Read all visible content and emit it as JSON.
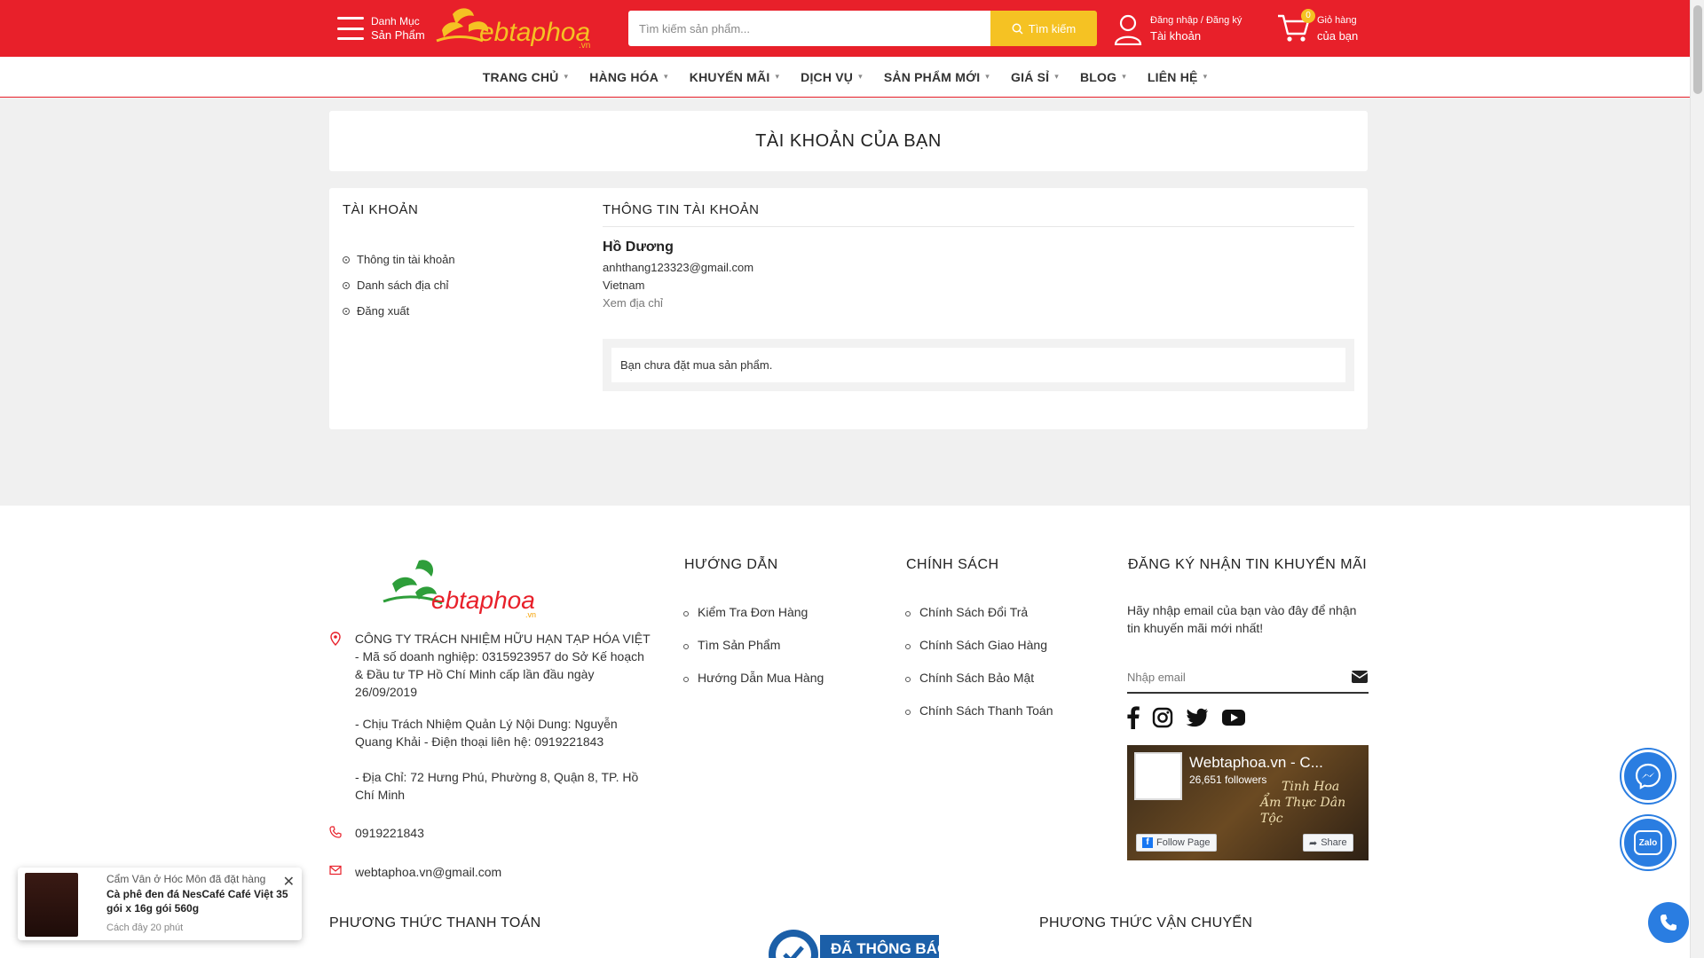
{
  "header": {
    "menu_line1": "Danh Mục",
    "menu_line2": "Sản Phẩm",
    "logo_text": "ebtaphoa",
    "logo_suffix": ".vn",
    "search_placeholder": "Tìm kiếm sản phẩm...",
    "search_button": "Tìm kiếm",
    "account_line1": "Đăng nhập / Đăng ký",
    "account_line2": "Tài khoản",
    "cart_count": "0",
    "cart_line1": "Giỏ hàng",
    "cart_line2": "của bạn",
    "brand_color": "#e8202a",
    "accent_color": "#f5c223"
  },
  "nav": {
    "items": [
      {
        "label": "TRANG CHỦ"
      },
      {
        "label": "HÀNG HÓA"
      },
      {
        "label": "KHUYẾN MÃI"
      },
      {
        "label": "DỊCH VỤ"
      },
      {
        "label": "SẢN PHẨM MỚI"
      },
      {
        "label": "GIÁ SỈ"
      },
      {
        "label": "BLOG"
      },
      {
        "label": "LIÊN HỆ"
      }
    ]
  },
  "page": {
    "title": "TÀI KHOẢN CỦA BẠN"
  },
  "sidebar": {
    "title": "TÀI KHOẢN",
    "items": [
      {
        "label": "Thông tin tài khoản"
      },
      {
        "label": "Danh sách địa chỉ"
      },
      {
        "label": "Đăng xuất"
      }
    ]
  },
  "account_info": {
    "title": "THÔNG TIN TÀI KHOẢN",
    "name": "Hồ Dương",
    "email": "anhthang123323@gmail.com",
    "country": "Vietnam",
    "address_link": "Xem địa chỉ",
    "orders_message": "Bạn chưa đặt mua sản phẩm."
  },
  "footer": {
    "company": "CÔNG TY TRÁCH NHIỆM HỮU HẠN TẠP HÓA VIỆT - Mã số doanh nghiệp: 0315923957 do Sở Kế hoạch & Đầu tư TP Hồ Chí Minh cấp lần đầu ngày 26/09/2019",
    "manager": "- Chịu Trách Nhiệm Quản Lý Nội Dung: Nguyễn Quang Khải - Điện thoại liên hệ: 0919221843",
    "address": "- Địa Chỉ: 72 Hưng Phú, Phường 8, Quận 8, TP. Hồ Chí Minh",
    "phone": "0919221843",
    "email": "webtaphoa.vn@gmail.com",
    "guide_title": "HƯỚNG DẪN",
    "guide_items": [
      {
        "label": "Kiểm Tra Đơn Hàng"
      },
      {
        "label": "Tìm Sản Phẩm"
      },
      {
        "label": "Hướng Dẫn Mua Hàng"
      }
    ],
    "policy_title": "CHÍNH SÁCH",
    "policy_items": [
      {
        "label": "Chính Sách Đổi Trả"
      },
      {
        "label": "Chính Sách Giao Hàng"
      },
      {
        "label": "Chính Sách Bảo Mật"
      },
      {
        "label": "Chính Sách Thanh Toán"
      }
    ],
    "subscribe_title": "ĐĂNG KÝ NHẬN TIN KHUYẾN MÃI",
    "subscribe_desc": "Hãy nhập email của bạn vào đây để nhận tin khuyến mãi mới nhất!",
    "email_placeholder": "Nhập email",
    "fb_name": "Webtaphoa.vn - C...",
    "fb_followers": "26,651 followers",
    "fb_slogan1": "Tinh Hoa",
    "fb_slogan2": "Ẩm Thực Dân Tộc",
    "fb_follow": "Follow Page",
    "fb_share": "Share",
    "payment_title": "PHƯƠNG THỨC THANH TOÁN",
    "shipping_title": "PHƯƠNG THỨC VẬN CHUYỂN",
    "stamp_text": "ĐÃ THÔNG BÁO"
  },
  "floating": {
    "zalo_label": "Zalo"
  },
  "notification": {
    "line1": "Cẩm Vân ở Hóc Môn đã đặt hàng",
    "product": "Cà phê đen đá NesCafé Café Việt 35 gói x 16g gói 560g",
    "time": "Cách đây 20 phút"
  }
}
